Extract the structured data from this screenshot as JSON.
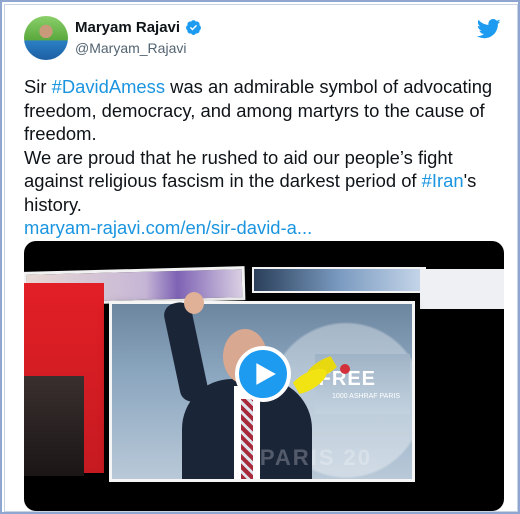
{
  "author": {
    "display_name": "Maryam Rajavi",
    "handle": "@Maryam_Rajavi",
    "verified": true
  },
  "tweet": {
    "line1_pre": "Sir ",
    "line1_tag": "#DavidAmess",
    "line1_post": " was an admirable symbol of advocating freedom, democracy, and among martyrs to the cause of freedom.",
    "line2_pre": "We are proud that he rushed to aid our people’s fight against religious fascism in the darkest period of ",
    "line2_tag": "#Iran",
    "line2_post": "'s history.",
    "link": "maryam-rajavi.com/en/sir-david-a..."
  },
  "media": {
    "type": "video",
    "banner_text": "FREE",
    "banner_sub": "1000 ASHRAF PARIS",
    "watermark": "PARIS 20"
  },
  "icons": {
    "brand": "twitter-bird-icon",
    "verified": "verified-badge-icon",
    "play": "play-icon"
  },
  "colors": {
    "link": "#1b95e0",
    "play": "#1d9bf0",
    "frame": "#8fa6d0"
  }
}
